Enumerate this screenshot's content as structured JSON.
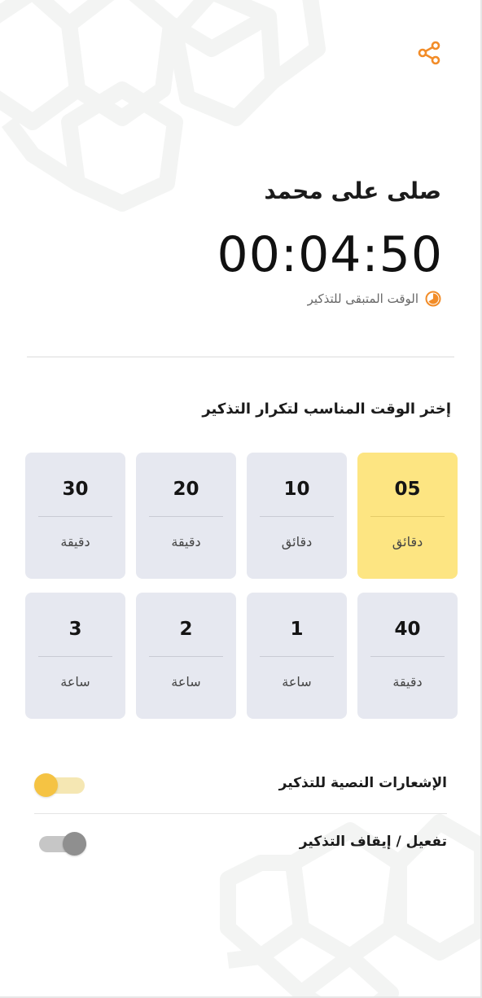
{
  "header": {
    "share_icon": "share-icon"
  },
  "dhikr": {
    "title": "صلى على محمد",
    "countdown": "00:04:50",
    "remaining_label": "الوقت المتبقى للتذكير",
    "remaining_icon": "timer-icon"
  },
  "intervals": {
    "heading": "إختر الوقت المناسب لتكرار التذكير",
    "selected_index": 0,
    "options": [
      {
        "value": "05",
        "unit": "دقائق"
      },
      {
        "value": "10",
        "unit": "دقائق"
      },
      {
        "value": "20",
        "unit": "دقيقة"
      },
      {
        "value": "30",
        "unit": "دقيقة"
      },
      {
        "value": "40",
        "unit": "دقيقة"
      },
      {
        "value": "1",
        "unit": "ساعة"
      },
      {
        "value": "2",
        "unit": "ساعة"
      },
      {
        "value": "3",
        "unit": "ساعة"
      }
    ]
  },
  "settings": {
    "text_notifications": {
      "label": "الإشعارات النصية للتذكير",
      "enabled": true
    },
    "enable_reminder": {
      "label": "تفعيل / إيقاف التذكير",
      "enabled": false
    }
  },
  "colors": {
    "accent": "#f28c28",
    "selected_card": "#fde582",
    "card": "#e6e8f0",
    "toggle_on": "#f5c343"
  }
}
